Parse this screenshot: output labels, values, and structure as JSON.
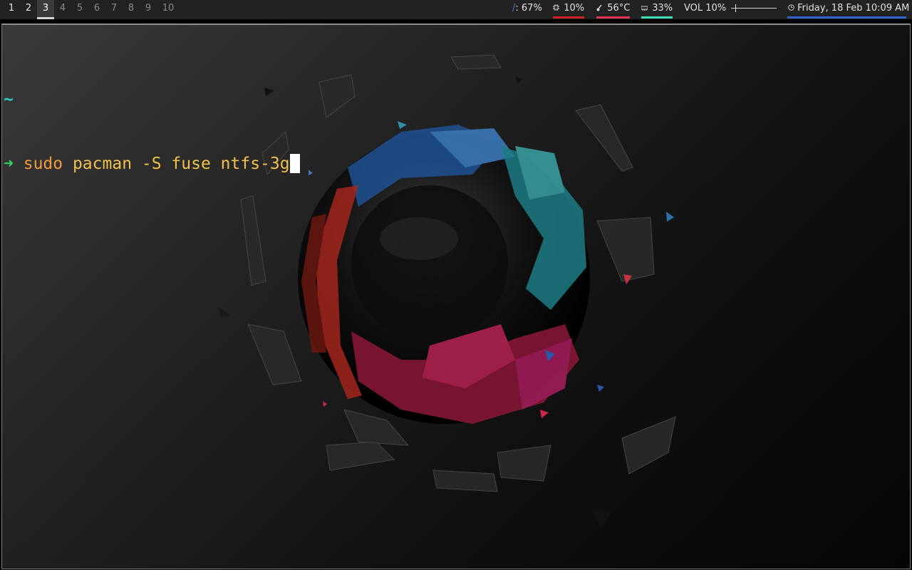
{
  "workspaces": [
    {
      "label": "1",
      "state": "occupied"
    },
    {
      "label": "2",
      "state": "occupied"
    },
    {
      "label": "3",
      "state": "active"
    },
    {
      "label": "4",
      "state": "empty"
    },
    {
      "label": "5",
      "state": "empty"
    },
    {
      "label": "6",
      "state": "empty"
    },
    {
      "label": "7",
      "state": "empty"
    },
    {
      "label": "8",
      "state": "empty"
    },
    {
      "label": "9",
      "state": "empty"
    },
    {
      "label": "10",
      "state": "empty"
    }
  ],
  "status": {
    "disk": {
      "icon": "/",
      "text": ": 67%",
      "icon_color": "#4a7bd8"
    },
    "cpu": {
      "icon": "cpu-icon",
      "text": "10%",
      "underline": "#d0212b"
    },
    "temp": {
      "icon": "thermometer-icon",
      "text": "56°C",
      "underline": "#e23355"
    },
    "memory": {
      "icon": "memory-icon",
      "text": "33%",
      "underline": "#3fe0b5"
    },
    "volume": {
      "label": "VOL 10%",
      "level": 0.1
    },
    "clock": {
      "icon": "clock-icon",
      "text": "Friday, 18 Feb 10:09 AM",
      "underline": "#2f62d0"
    }
  },
  "terminal": {
    "cwd": "~",
    "prompt_symbol": "➜",
    "command_head": "sudo",
    "command_rest": " pacman -S fuse ntfs-3g"
  },
  "colors": {
    "bar_bg": "#222222",
    "prompt_cwd": "#2fd3c2",
    "prompt_arrow": "#33d46a",
    "command_sudo": "#f19a3c",
    "command_args": "#f2c14b"
  }
}
